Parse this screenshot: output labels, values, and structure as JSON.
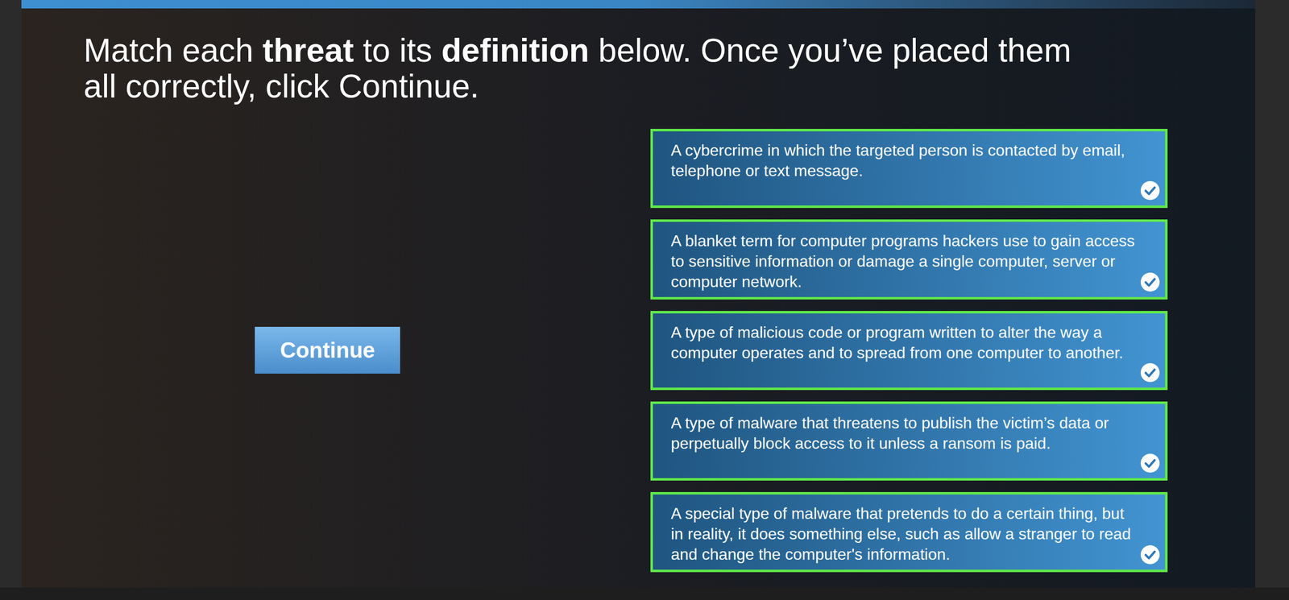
{
  "instruction": [
    {
      "text": "Match each ",
      "bold": false
    },
    {
      "text": "threat",
      "bold": true
    },
    {
      "text": " to its ",
      "bold": false
    },
    {
      "text": "definition",
      "bold": true
    },
    {
      "text": " below. Once you’ve placed them all correctly, click Continue.",
      "bold": false
    }
  ],
  "continue_button": {
    "label": "Continue"
  },
  "definitions": [
    {
      "text": "A cybercrime in which the targeted person is contacted by email, telephone or text message.",
      "correct": true
    },
    {
      "text": "A blanket term for computer programs hackers use to gain access to sensitive information or damage a single computer, server or computer network.",
      "correct": true
    },
    {
      "text": "A type of malicious code or program written to alter the way a computer operates and to spread from one computer to another.",
      "correct": true
    },
    {
      "text": "A type of malware that threatens to publish the victim’s data or perpetually block access to it unless a ransom is paid.",
      "correct": true
    },
    {
      "text": "A special type of malware that pretends to do a certain thing, but in reality, it does something else, such as allow a stranger to read and change the computer's information.",
      "correct": true
    }
  ]
}
